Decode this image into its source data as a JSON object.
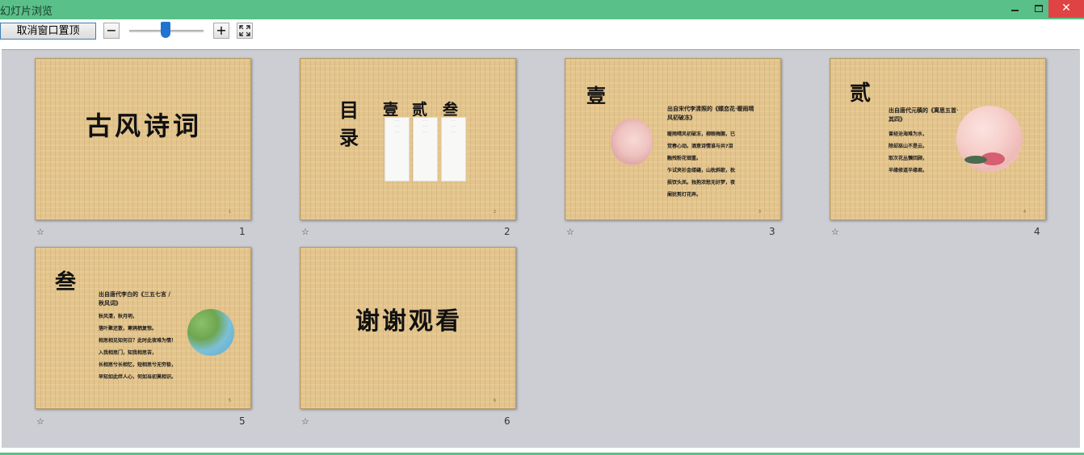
{
  "window": {
    "title": "幻灯片浏览",
    "controls": [
      "minimize",
      "maximize",
      "close"
    ]
  },
  "toolbar": {
    "pin_label": "取消窗口置顶",
    "zoom_out_label": "−",
    "zoom_in_label": "+",
    "zoom_level": 0.5
  },
  "slides": [
    {
      "number": "1",
      "star": "☆",
      "title": "古风诗词"
    },
    {
      "number": "2",
      "star": "☆",
      "title_a": "目",
      "title_b": "录",
      "sections": [
        "壹",
        "贰",
        "叁"
      ]
    },
    {
      "number": "3",
      "star": "☆",
      "heading": "壹",
      "subtitle": "出自宋代李清照的《蝶恋花·暖雨晴风初破冻》",
      "lines": [
        "暖雨晴风初破冻，柳眼梅腮，已",
        "觉春心动。酒意诗情谁与共?泪",
        "融残粉花钿重。",
        "乍试夹衫金缕缝，山枕斜欹，枕",
        "损钗头凤。独抱浓愁无好梦，夜",
        "阑犹剪灯花弄。"
      ]
    },
    {
      "number": "4",
      "star": "☆",
      "heading": "贰",
      "subtitle": "出自唐代元稹的《离思五首·其四》",
      "lines": [
        "曾经沧海难为水，",
        "除却巫山不是云。",
        "取次花丛懒回顾，",
        "半缘修道半缘君。"
      ]
    },
    {
      "number": "5",
      "star": "☆",
      "heading": "叁",
      "subtitle": "出自唐代李白的《三五七言 / 秋风词》",
      "lines": [
        "秋风清，秋月明，",
        "落叶聚还散，寒鸦栖复惊。",
        "相思相见知何日？此时此夜难为情！",
        "入我相思门，知我相思苦，",
        "长相思兮长相忆，短相思兮无穷极，",
        "早知如此绊人心，何如当初莫相识。"
      ]
    },
    {
      "number": "6",
      "star": "☆",
      "title": "谢谢观看"
    }
  ]
}
